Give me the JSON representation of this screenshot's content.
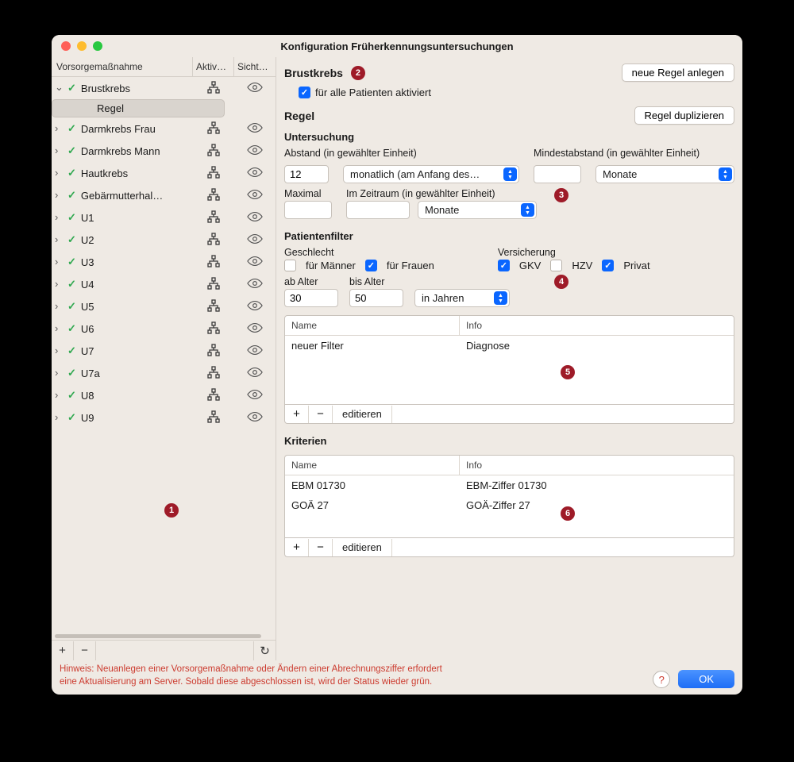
{
  "window": {
    "title": "Konfiguration Früherkennungsuntersuchungen"
  },
  "sidebar": {
    "headers": {
      "name": "Vorsorgemaßnahme",
      "active": "Aktiv…",
      "visible": "Sicht…"
    },
    "items": [
      {
        "label": "Brustkrebs",
        "expanded": true
      },
      {
        "label": "Regel",
        "child": true,
        "selected": true
      },
      {
        "label": "Darmkrebs Frau"
      },
      {
        "label": "Darmkrebs Mann"
      },
      {
        "label": "Hautkrebs"
      },
      {
        "label": "Gebärmutterhal…"
      },
      {
        "label": "U1"
      },
      {
        "label": "U2"
      },
      {
        "label": "U3"
      },
      {
        "label": "U4"
      },
      {
        "label": "U5"
      },
      {
        "label": "U6"
      },
      {
        "label": "U7"
      },
      {
        "label": "U7a"
      },
      {
        "label": "U8"
      },
      {
        "label": "U9"
      }
    ]
  },
  "detail": {
    "heading": "Brustkrebs",
    "new_rule_btn": "neue Regel anlegen",
    "activate_all": "für alle Patienten aktiviert",
    "rule_heading": "Regel",
    "dup_rule_btn": "Regel duplizieren"
  },
  "untersuchung": {
    "title": "Untersuchung",
    "abstand_label": "Abstand (in gewählter Einheit)",
    "abstand_value": "12",
    "abstand_unit": "monatlich (am Anfang des…",
    "mindest_label": "Mindestabstand (in gewählter Einheit)",
    "mindest_unit": "Monate",
    "maximal_label": "Maximal",
    "zeitraum_label": "Im Zeitraum (in gewählter Einheit)",
    "zeitraum_unit": "Monate"
  },
  "patientenfilter": {
    "title": "Patientenfilter",
    "geschlecht_label": "Geschlecht",
    "male": "für Männer",
    "female": "für Frauen",
    "versicherung_label": "Versicherung",
    "gkv": "GKV",
    "hzv": "HZV",
    "privat": "Privat",
    "ab_alter_label": "ab Alter",
    "bis_alter_label": "bis Alter",
    "ab_alter_value": "30",
    "bis_alter_value": "50",
    "alter_unit": "in Jahren",
    "table": {
      "name_h": "Name",
      "info_h": "Info",
      "rows": [
        {
          "name": "neuer Filter",
          "info": "Diagnose"
        }
      ],
      "edit": "editieren"
    }
  },
  "kriterien": {
    "title": "Kriterien",
    "name_h": "Name",
    "info_h": "Info",
    "rows": [
      {
        "name": "EBM 01730",
        "info": "EBM-Ziffer 01730"
      },
      {
        "name": "GOÄ 27",
        "info": "GOÄ-Ziffer 27"
      }
    ],
    "edit": "editieren"
  },
  "footer": {
    "hint": "Hinweis: Neuanlegen einer Vorsorgemaßnahme oder Ändern einer Abrechnungsziffer erfordert\neine Aktualisierung am Server. Sobald diese abgeschlossen ist, wird der Status wieder grün.",
    "ok": "OK"
  },
  "badges": {
    "b1": "1",
    "b2": "2",
    "b3": "3",
    "b4": "4",
    "b5": "5",
    "b6": "6"
  }
}
